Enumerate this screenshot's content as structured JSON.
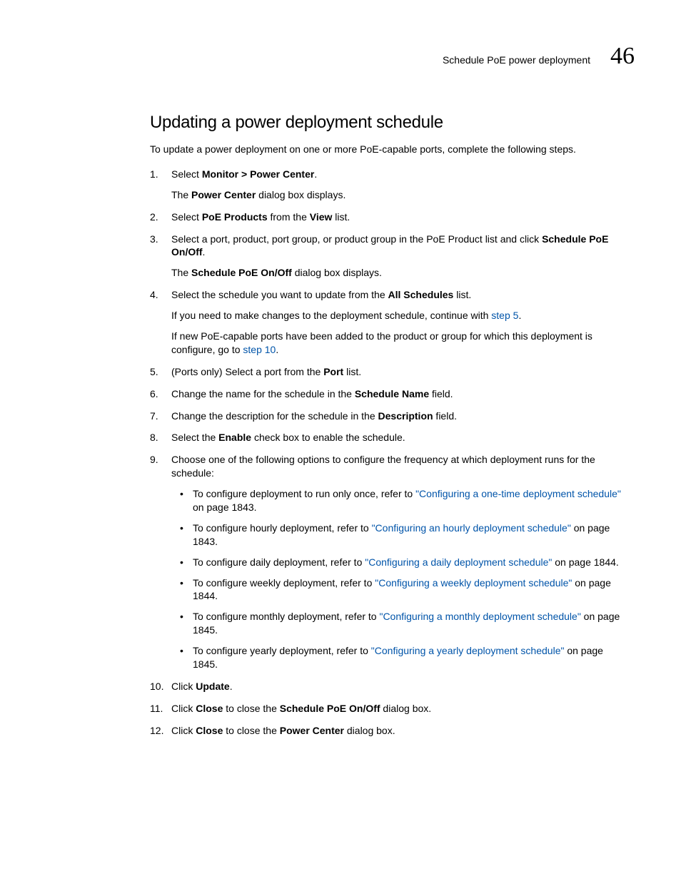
{
  "header": {
    "running_title": "Schedule PoE power deployment",
    "chapter_number": "46"
  },
  "section": {
    "title": "Updating a power deployment schedule",
    "intro": "To update a power deployment on one or more PoE-capable ports, complete the following steps."
  },
  "steps": {
    "s1a": "Select ",
    "s1b": "Monitor > Power Center",
    "s1c": ".",
    "s1d": "The ",
    "s1e": "Power Center",
    "s1f": " dialog box displays.",
    "s2a": "Select ",
    "s2b": "PoE Products",
    "s2c": " from the ",
    "s2d": "View",
    "s2e": " list.",
    "s3a": "Select a port, product, port group, or product group in the PoE Product list and click ",
    "s3b": "Schedule PoE On/Off",
    "s3c": ".",
    "s3d": "The ",
    "s3e": "Schedule PoE On/Off",
    "s3f": " dialog box displays.",
    "s4a": "Select the schedule you want to update from the ",
    "s4b": "All Schedules",
    "s4c": " list.",
    "s4d": "If you need to make changes to the deployment schedule, continue with ",
    "s4e": "step 5",
    "s4f": ".",
    "s4g": "If new PoE-capable ports have been added to the product or group for which this deployment is configure, go to ",
    "s4h": "step 10",
    "s4i": ".",
    "s5a": "(Ports only) Select a port from the ",
    "s5b": "Port",
    "s5c": " list.",
    "s6a": "Change the name for the schedule in the ",
    "s6b": "Schedule Name",
    "s6c": " field.",
    "s7a": "Change the description for the schedule in the ",
    "s7b": "Description",
    "s7c": " field.",
    "s8a": "Select the ",
    "s8b": "Enable",
    "s8c": " check box to enable the schedule.",
    "s9a": "Choose one of the following options to configure the frequency at which deployment runs for the schedule:",
    "s10a": "Click ",
    "s10b": "Update",
    "s10c": ".",
    "s11a": "Click ",
    "s11b": "Close",
    "s11c": " to close the ",
    "s11d": "Schedule PoE On/Off",
    "s11e": " dialog box.",
    "s12a": "Click ",
    "s12b": "Close",
    "s12c": " to close the ",
    "s12d": "Power Center",
    "s12e": " dialog box."
  },
  "bullets": {
    "b1a": "To configure deployment to run only once, refer to ",
    "b1b": "\"Configuring a one-time deployment schedule\"",
    "b1c": " on page 1843.",
    "b2a": "To configure hourly deployment, refer to ",
    "b2b": "\"Configuring an hourly deployment schedule\"",
    "b2c": " on page 1843.",
    "b3a": "To configure daily deployment, refer to ",
    "b3b": "\"Configuring a daily deployment schedule\"",
    "b3c": " on page 1844.",
    "b4a": "To configure weekly deployment, refer to ",
    "b4b": "\"Configuring a weekly deployment schedule\"",
    "b4c": " on page 1844.",
    "b5a": "To configure monthly deployment, refer to ",
    "b5b": "\"Configuring a monthly deployment schedule\"",
    "b5c": " on page 1845.",
    "b6a": "To configure yearly deployment, refer to ",
    "b6b": "\"Configuring a yearly deployment schedule\"",
    "b6c": " on page 1845."
  }
}
